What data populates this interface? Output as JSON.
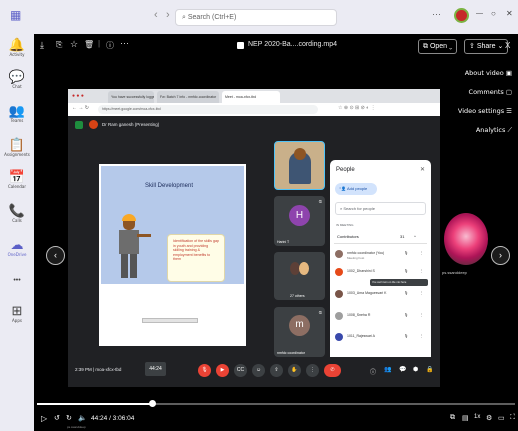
{
  "teams": {
    "search_placeholder": "Search (Ctrl+E)",
    "nav_back": "‹",
    "nav_forward": "›",
    "window_controls": [
      "—",
      "○",
      "✕"
    ],
    "rail": [
      {
        "label": "Activity",
        "icon": "bell-icon",
        "glyph": "🔔"
      },
      {
        "label": "Chat",
        "icon": "chat-icon",
        "glyph": "💬"
      },
      {
        "label": "Teams",
        "icon": "teams-icon",
        "glyph": "👥"
      },
      {
        "label": "Assignments",
        "icon": "assignments-icon",
        "glyph": "📋"
      },
      {
        "label": "Calendar",
        "icon": "calendar-icon",
        "glyph": "📅"
      },
      {
        "label": "Calls",
        "icon": "phone-icon",
        "glyph": "📞"
      },
      {
        "label": "OneDrive",
        "icon": "cloud-icon",
        "glyph": "☁"
      },
      {
        "label": "",
        "icon": "more-icon",
        "glyph": "•••"
      },
      {
        "label": "Apps",
        "icon": "apps-icon",
        "glyph": "⊞"
      }
    ]
  },
  "player": {
    "file_title": "NEP 2020-Ba....cording.mp4",
    "open_label": "Open",
    "share_label": "Share",
    "close_glyph": "X",
    "side_menu": [
      "About video",
      "Comments",
      "Video settings",
      "Analytics"
    ],
    "thumb_label": "ps.ssanddeep",
    "time_display": "44:24 / 3:06:04",
    "hover_time": "44:24",
    "progress_fraction": 0.24,
    "small_label": "ps.ssanddeep"
  },
  "browser": {
    "tab_1": "You have successfully logged in",
    "tab_2": "Fw: Batch 7 info - nmfdc.coordinator",
    "tab_3": "Meet - moa-xfcx-tbd",
    "url": "https://meet.google.com/moa-xfcx-tbd"
  },
  "meet": {
    "presenting": "Dr Ram ganesh (Presenting)",
    "slide_title": "Skill Development",
    "slide_text": "Identification of the skills gap in youth and providing skilling training & employment benefits to them",
    "slide_footer": "",
    "tiles": [
      {
        "label": "",
        "initial": ""
      },
      {
        "label": "Harini T",
        "initial": "H"
      },
      {
        "label": "27 others",
        "initial": ""
      },
      {
        "label": "nmfdc coordinator",
        "initial": "m"
      }
    ],
    "time_code": "2:39 PM  |  moa-xfcx-tbd",
    "people_panel": {
      "title": "People",
      "add_label": "Add people",
      "search_placeholder": "Search for people",
      "section": "IN MEETING",
      "group": "Contributors",
      "count": "31",
      "tooltip": "You can't turn on the mic here",
      "rows": [
        {
          "name": "nmfdc coordinator (You)",
          "sub": "Meeting host",
          "color": "#8d6e63"
        },
        {
          "name": "1002_Dharshini S",
          "sub": "",
          "color": "#e64a19"
        },
        {
          "name": "1003_Uma Maguesvari K",
          "sub": "",
          "color": "#795548"
        },
        {
          "name": "1008_Sneha R",
          "sub": "",
          "color": "#9e9e9e"
        },
        {
          "name": "1011_Rajeswari A",
          "sub": "",
          "color": "#3949ab"
        }
      ]
    }
  }
}
